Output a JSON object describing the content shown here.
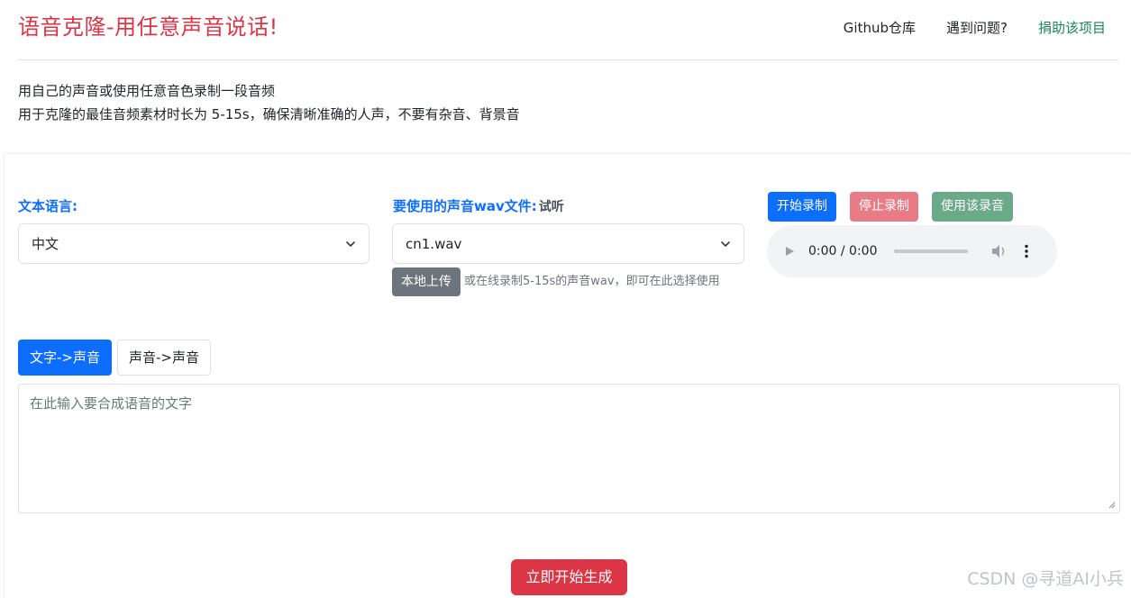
{
  "header": {
    "title": "语音克隆-用任意声音说话!",
    "nav": {
      "github": "Github仓库",
      "issues": "遇到问题?",
      "donate": "捐助该项目"
    }
  },
  "intro": {
    "line1": "用自己的声音或使用任意音色录制一段音频",
    "line2": "用于克隆的最佳音频素材时长为 5-15s，确保清晰准确的人声，不要有杂音、背景音"
  },
  "language": {
    "label": "文本语言:",
    "selected": "中文"
  },
  "voice": {
    "label": "要使用的声音wav文件:",
    "preview": "试听",
    "selected": "cn1.wav",
    "upload_button": "本地上传",
    "upload_hint": "或在线录制5-15s的声音wav，即可在此选择使用"
  },
  "recorder": {
    "start": "开始录制",
    "stop": "停止录制",
    "use": "使用该录音",
    "time": "0:00 / 0:00"
  },
  "tabs": [
    {
      "label": "文字->声音",
      "active": true
    },
    {
      "label": "声音->声音",
      "active": false
    }
  ],
  "text_input": {
    "placeholder": "在此输入要合成语音的文字"
  },
  "generate_button": "立即开始生成",
  "watermark": "CSDN @寻道AI小兵",
  "colors": {
    "title": "#dc3545",
    "primary": "#0d6efd",
    "donate": "#198754",
    "secondary": "#6c757d"
  }
}
